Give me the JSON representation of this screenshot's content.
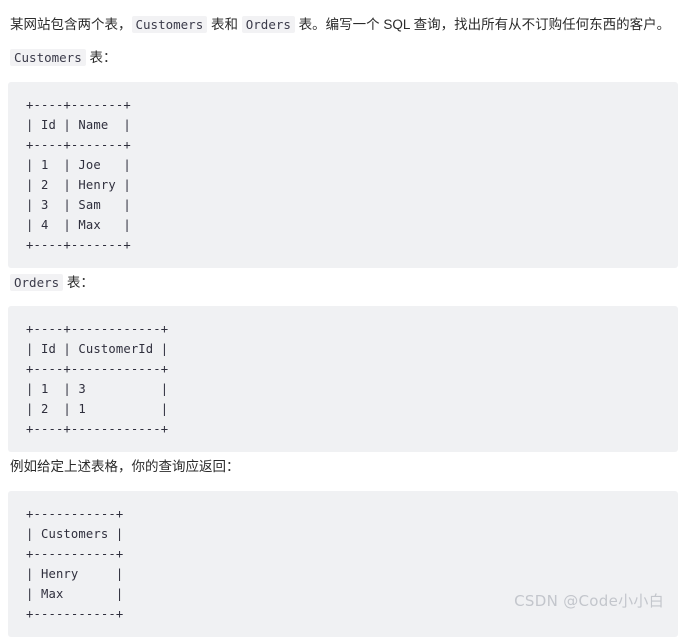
{
  "document": {
    "intro": {
      "segment_1": "某网站包含两个表，",
      "code_1": "Customers",
      "segment_2": " 表和 ",
      "code_2": "Orders",
      "segment_3": " 表。编写一个 SQL 查询，找出所有从不订购任何东西的客户。"
    },
    "label_customers": {
      "code": "Customers",
      "suffix": " 表："
    },
    "label_orders": {
      "code": "Orders",
      "suffix": " 表："
    },
    "label_example": "例如给定上述表格，你的查询应返回："
  },
  "code_blocks": {
    "customers": {
      "columns": [
        "Id",
        "Name"
      ],
      "rows": [
        [
          "1",
          "Joe"
        ],
        [
          "2",
          "Henry"
        ],
        [
          "3",
          "Sam"
        ],
        [
          "4",
          "Max"
        ]
      ],
      "text": "+----+-------+\n| Id | Name  |\n+----+-------+\n| 1  | Joe   |\n| 2  | Henry |\n| 3  | Sam   |\n| 4  | Max   |\n+----+-------+"
    },
    "orders": {
      "columns": [
        "Id",
        "CustomerId"
      ],
      "rows": [
        [
          "1",
          "3"
        ],
        [
          "2",
          "1"
        ]
      ],
      "text": "+----+------------+\n| Id | CustomerId |\n+----+------------+\n| 1  | 3          |\n| 2  | 1          |\n+----+------------+"
    },
    "result": {
      "columns": [
        "Customers"
      ],
      "rows": [
        [
          "Henry"
        ],
        [
          "Max"
        ]
      ],
      "text": "+-----------+\n| Customers |\n+-----------+\n| Henry     |\n| Max       |\n+-----------+"
    }
  },
  "watermark": {
    "text": "CSDN @Code小小白"
  },
  "colors": {
    "code_block_background": "#f0f1f3",
    "inline_code_background": "#f2f2f4",
    "text": "#2b2b2b",
    "code_text": "#2f2f3d",
    "watermark": "#c3c6cc",
    "page_background": "#ffffff"
  }
}
